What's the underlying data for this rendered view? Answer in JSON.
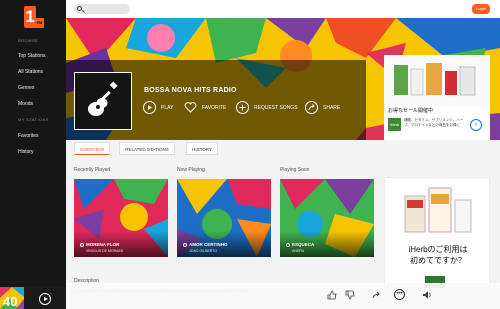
{
  "sidebar": {
    "logo": "1",
    "logo_sub": "FM",
    "browse_label": "BROWSE",
    "items": [
      {
        "label": "Top Stations"
      },
      {
        "label": "All Stations"
      },
      {
        "label": "Genres"
      },
      {
        "label": "Moods"
      }
    ],
    "my_label": "MY STATIONS",
    "my_items": [
      {
        "label": "Favorites"
      },
      {
        "label": "History"
      }
    ],
    "badge": "40"
  },
  "topbar": {
    "search_placeholder": "",
    "login_label": "Login"
  },
  "station": {
    "title": "BOSSA NOVA HITS RADIO",
    "actions": {
      "play": "PLAY",
      "favorite": "FAVORITE",
      "request": "REQUEST SONGS",
      "share": "SHARE"
    }
  },
  "ad_top": {
    "headline": "お得なセール開催中",
    "brand": "iHerb",
    "body": "通販、ビタミン、サプリメント、ハーブ、プロテインなどの商品をお得に"
  },
  "tabs": [
    {
      "label": "OVERVIEW",
      "active": true
    },
    {
      "label": "RELATED STATIONS",
      "active": false
    },
    {
      "label": "HISTORY",
      "active": false
    }
  ],
  "columns": {
    "recent": "Recently Played",
    "now": "Now Playing",
    "soon": "Playing Soon"
  },
  "cards": [
    {
      "song": "MORENA FLOR",
      "artist": "VINICIUS DE MORAES"
    },
    {
      "song": "AMOR CERTINHO",
      "artist": "JOAO GILBERTO"
    },
    {
      "song": "ESQUECA",
      "artist": "ANDRA"
    }
  ],
  "ad_side": {
    "line1": "iHerbのご利用は",
    "line2": "初めてですか？"
  },
  "description": {
    "label": "Description",
    "text": "A great fusion of soft samba and jazz, this radio station you create with the smoother side of Brazil"
  },
  "player": {
    "icons": [
      "thumbs-up-icon",
      "thumbs-down-icon",
      "share-icon",
      "more-icon",
      "volume-icon"
    ]
  },
  "colors": {
    "accent": "#ff5a1f",
    "sidebar": "#161616"
  }
}
